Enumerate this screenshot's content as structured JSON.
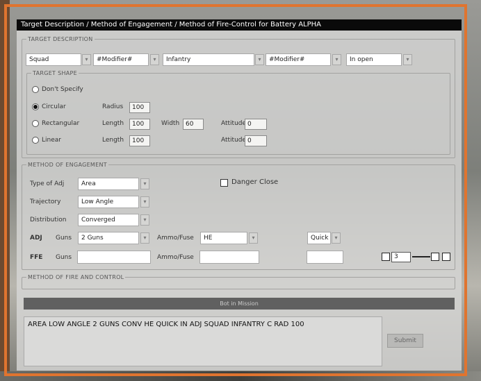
{
  "title": "Target Description / Method of Engagement / Method of Fire-Control for Battery ALPHA",
  "target_description": {
    "legend": "TARGET DESCRIPTION",
    "combos": [
      {
        "value": "Squad"
      },
      {
        "value": "#Modifier#"
      },
      {
        "value": "Infantry"
      },
      {
        "value": "#Modifier#"
      },
      {
        "value": "In open"
      }
    ]
  },
  "target_shape": {
    "legend": "TARGET SHAPE",
    "options": [
      "Don't Specify",
      "Circular",
      "Rectangular",
      "Linear"
    ],
    "selected": "Circular",
    "radius_label": "Radius",
    "radius_value": "100",
    "length_label": "Length",
    "rect_length_value": "100",
    "width_label": "Width",
    "width_value": "60",
    "attitude_label": "Attitude",
    "rect_attitude_value": "0",
    "linear_length_value": "100",
    "linear_attitude_value": "0"
  },
  "method_of_engagement": {
    "legend": "METHOD OF ENGAGEMENT",
    "type_label": "Type of Adj",
    "type_value": "Area",
    "trajectory_label": "Trajectory",
    "trajectory_value": "Low Angle",
    "distribution_label": "Distribution",
    "distribution_value": "Converged",
    "danger_close_label": "Danger Close",
    "adj_label": "ADJ",
    "guns_label": "Guns",
    "adj_guns_value": "2 Guns",
    "ammo_label": "Ammo/Fuse",
    "adj_ammo_value": "HE",
    "adj_fuse_value": "Quick",
    "ffe_label": "FFE",
    "ffe_guns_value": "",
    "ffe_ammo_value": "",
    "ffe_extra_value": "",
    "rounds_value": "3"
  },
  "method_of_fire_control": {
    "legend": "METHOD OF FIRE AND CONTROL"
  },
  "bar_label": "Bot in Mission",
  "output_text": "AREA LOW ANGLE 2 GUNS CONV HE QUICK IN ADJ SQUAD INFANTRY C RAD 100",
  "submit_label": "Submit",
  "colors": {
    "frame": "#e0742f",
    "titlebar": "#0a0a0a"
  }
}
